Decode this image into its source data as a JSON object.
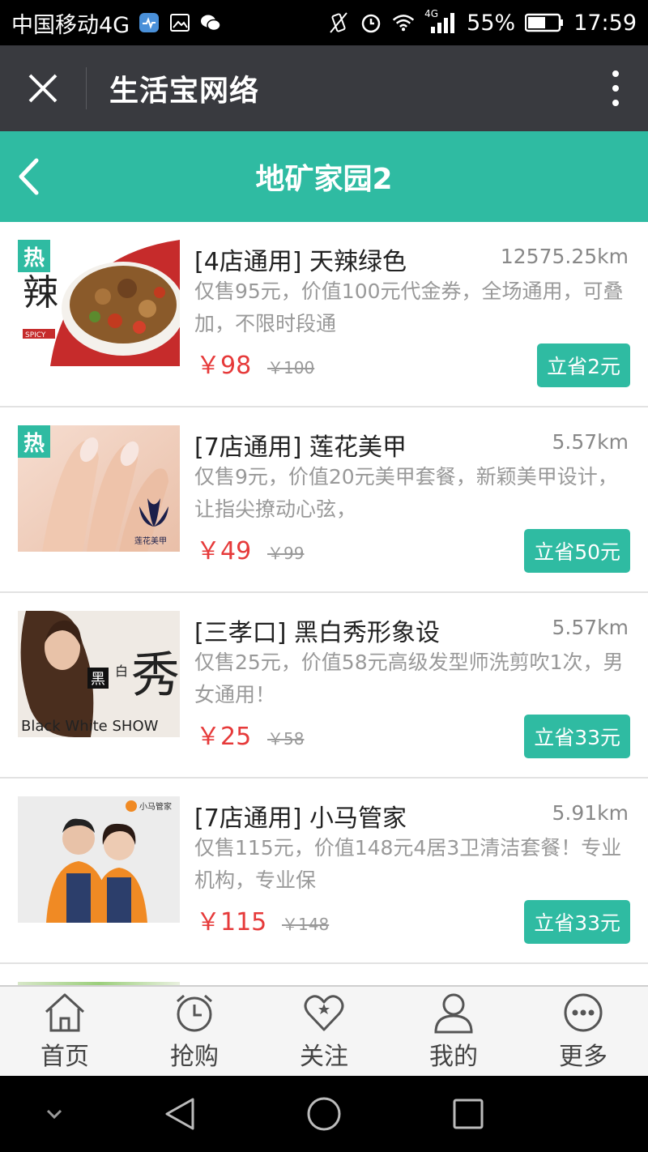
{
  "status_bar": {
    "carrier": "中国移动4G",
    "net": "4G",
    "battery": "55%",
    "time": "17:59"
  },
  "title_bar": {
    "title": "生活宝网络"
  },
  "nav": {
    "title": "地矿家园2"
  },
  "colors": {
    "accent": "#2fbba2",
    "price": "#e63a3a",
    "titlebar": "#393a3f"
  },
  "items": [
    {
      "title": "[4店通用] 天辣绿色",
      "distance": "12575.25km",
      "desc": "仅售95元，价值100元代金券，全场通用，可叠加，不限时段通",
      "price": "￥98",
      "original": "￥100",
      "save": "立省2元",
      "hot_badge": "热",
      "thumb_text": "辣",
      "thumb_sub": "SPICY"
    },
    {
      "title": "[7店通用] 莲花美甲",
      "distance": "5.57km",
      "desc": "仅售9元，价值20元美甲套餐，新颖美甲设计，让指尖撩动心弦，",
      "price": "￥49",
      "original": "￥99",
      "save": "立省50元",
      "hot_badge": "热",
      "thumb_text": "莲花美甲"
    },
    {
      "title": "[三孝口] 黑白秀形象设",
      "distance": "5.57km",
      "desc": "仅售25元，价值58元高级发型师洗剪吹1次，男女通用！",
      "price": "￥25",
      "original": "￥58",
      "save": "立省33元",
      "thumb_text": "秀",
      "thumb_mid": "黑",
      "thumb_mid2": "白",
      "thumb_sub": "Black White SHOW"
    },
    {
      "title": "[7店通用] 小马管家",
      "distance": "5.91km",
      "desc": "仅售115元，价值148元4居3卫清洁套餐！专业机构，专业保",
      "price": "￥115",
      "original": "￥148",
      "save": "立省33元",
      "thumb_text": "小马管家"
    }
  ],
  "tabs": [
    {
      "label": "首页",
      "icon": "home-icon"
    },
    {
      "label": "抢购",
      "icon": "alarm-clock-icon"
    },
    {
      "label": "关注",
      "icon": "heart-icon"
    },
    {
      "label": "我的",
      "icon": "person-icon"
    },
    {
      "label": "更多",
      "icon": "more-dots-icon"
    }
  ]
}
